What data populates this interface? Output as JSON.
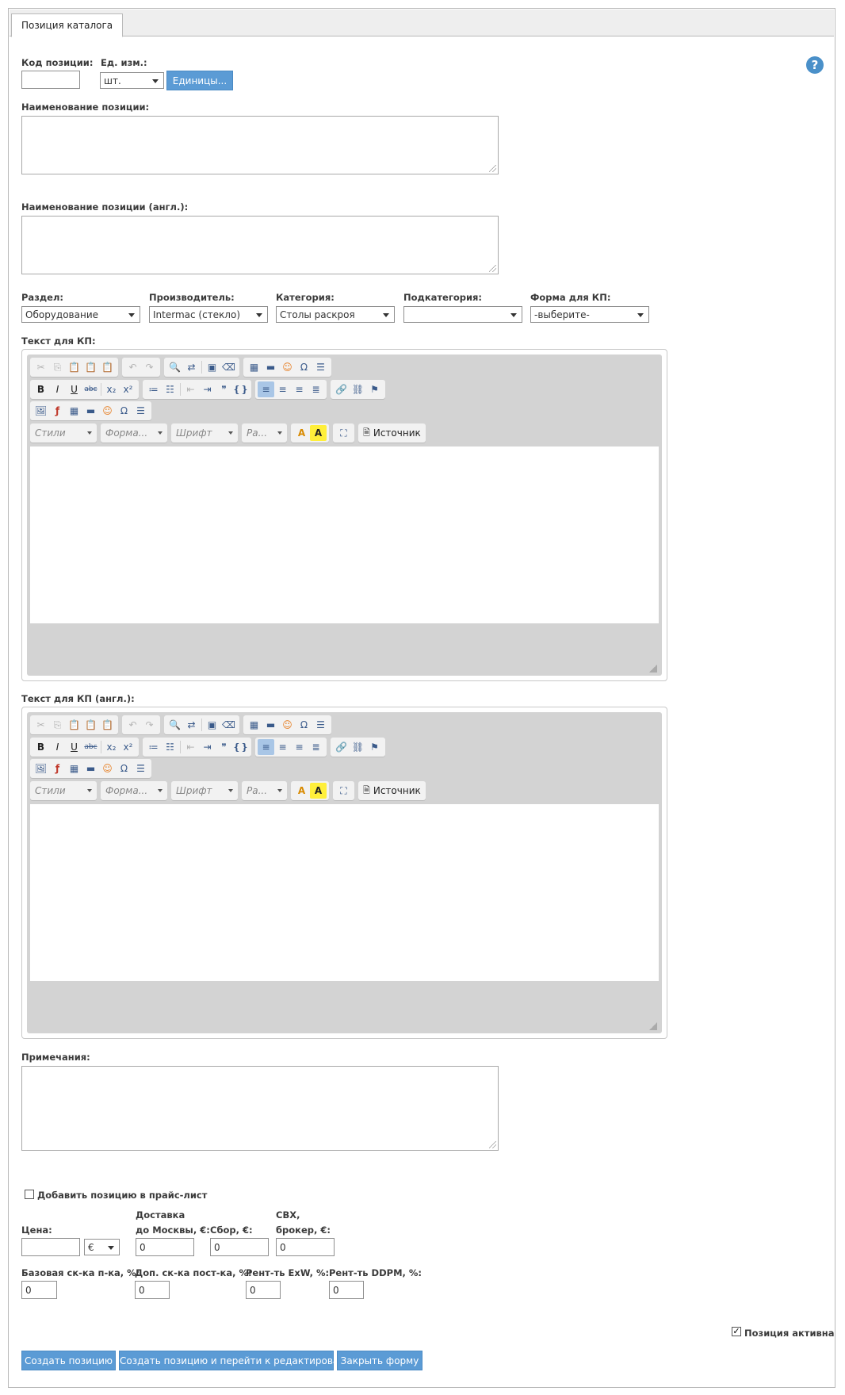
{
  "tab": {
    "label": "Позиция каталога"
  },
  "help": {
    "glyph": "?"
  },
  "code": {
    "label": "Код позиции:",
    "value": ""
  },
  "unit": {
    "label": "Ед. изм.:",
    "selected": "шт.",
    "button": "Единицы..."
  },
  "name": {
    "label": "Наименование позиции:",
    "value": ""
  },
  "name_en": {
    "label": "Наименование позиции (англ.):",
    "value": ""
  },
  "filters": {
    "section": {
      "label": "Раздел:",
      "selected": "Оборудование"
    },
    "manufacturer": {
      "label": "Производитель:",
      "selected": "Intermac (стекло)"
    },
    "category": {
      "label": "Категория:",
      "selected": "Столы раскроя"
    },
    "subcategory": {
      "label": "Подкатегория:",
      "selected": ""
    },
    "form": {
      "label": "Форма для КП:",
      "selected": "-выберите-"
    }
  },
  "editor1": {
    "label": "Текст для КП:"
  },
  "editor2": {
    "label": "Текст для КП (англ.):"
  },
  "toolbar": {
    "styles": "Стили",
    "format": "Форма...",
    "font": "Шрифт",
    "size": "Ра...",
    "source": "Источник",
    "icons": [
      "cut-icon",
      "copy-icon",
      "paste-icon",
      "paste-text-icon",
      "paste-word-icon",
      "undo-icon",
      "redo-icon",
      "find-icon",
      "replace-icon",
      "select-all-icon",
      "remove-format-icon",
      "table-icon",
      "horizontal-rule-icon",
      "smiley-icon",
      "special-char-icon",
      "page-break-icon",
      "bold-icon",
      "italic-icon",
      "underline-icon",
      "strike-icon",
      "subscript-icon",
      "superscript-icon",
      "numbered-list-icon",
      "bulleted-list-icon",
      "outdent-icon",
      "indent-icon",
      "blockquote-icon",
      "div-icon",
      "align-left-icon",
      "align-center-icon",
      "align-right-icon",
      "justify-icon",
      "link-icon",
      "unlink-icon",
      "anchor-icon",
      "image-icon",
      "flash-icon",
      "text-color-icon",
      "bg-color-icon",
      "maximize-icon"
    ]
  },
  "notes": {
    "label": "Примечания:",
    "value": ""
  },
  "pricelist": {
    "label": "Добавить позицию в прайс-лист",
    "checked": false
  },
  "price": {
    "price_label": "Цена:",
    "price_value": "",
    "currency": "€",
    "delivery_label_1": "Доставка",
    "delivery_label_2": "до Москвы, €:",
    "delivery_value": "0",
    "fee_label": "Сбор, €:",
    "fee_value": "0",
    "svh_label_1": "СВХ,",
    "svh_label_2": "брокер, €:",
    "svh_value": "0",
    "base_disc_label": "Базовая ск-ка п-ка, %:",
    "base_disc_value": "0",
    "add_disc_label": "Доп. ск-ка пост-ка, %:",
    "add_disc_value": "0",
    "exw_label": "Рент-ть ExW, %:",
    "exw_value": "0",
    "ddpm_label": "Рент-ть DDPM, %:",
    "ddpm_value": "0"
  },
  "active": {
    "label": "Позиция активна",
    "checked": true
  },
  "buttons": {
    "create": "Создать позицию",
    "create_edit": "Создать позицию и перейти к редактированию",
    "close": "Закрыть форму"
  }
}
